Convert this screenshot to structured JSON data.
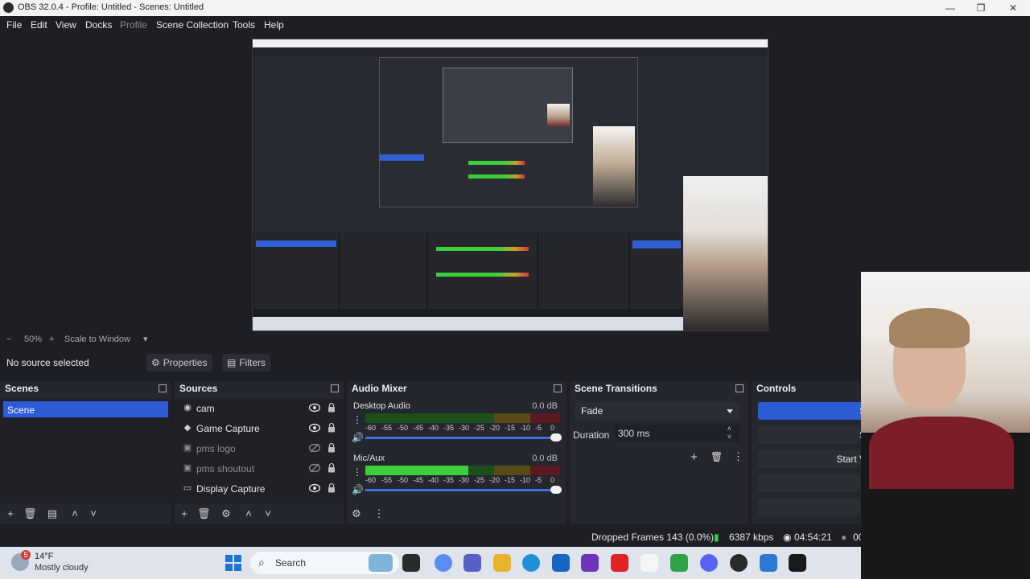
{
  "window": {
    "title": "OBS 32.0.4 - Profile: Untitled - Scenes: Untitled",
    "minimize": "—",
    "maximize": "❐",
    "close": "✕"
  },
  "menu": [
    "File",
    "Edit",
    "View",
    "Docks",
    "Profile",
    "Scene Collection",
    "Tools",
    "Help"
  ],
  "zoom": {
    "minus": "−",
    "value": "50%",
    "plus": "+",
    "mode": "Scale to Window"
  },
  "source_toolbar": {
    "status": "No source selected",
    "properties_label": "Properties",
    "filters_label": "Filters"
  },
  "scenes": {
    "title": "Scenes",
    "items": [
      "Scene"
    ]
  },
  "sources": {
    "title": "Sources",
    "items": [
      {
        "name": "cam",
        "icon": "camera-icon",
        "visible": true
      },
      {
        "name": "Game Capture",
        "icon": "gamepad-icon",
        "visible": true
      },
      {
        "name": "pms logo",
        "icon": "image-icon",
        "visible": false
      },
      {
        "name": "pms shoutout",
        "icon": "image-icon",
        "visible": false
      },
      {
        "name": "Display Capture",
        "icon": "monitor-icon",
        "visible": true
      }
    ]
  },
  "mixer": {
    "title": "Audio Mixer",
    "channels": [
      {
        "name": "Desktop Audio",
        "db": "0.0 dB",
        "level": 0.0
      },
      {
        "name": "Mic/Aux",
        "db": "0.0 dB",
        "level": 0.53
      }
    ],
    "ticks": [
      "-60",
      "-55",
      "-50",
      "-45",
      "-40",
      "-35",
      "-30",
      "-25",
      "-20",
      "-15",
      "-10",
      "-5",
      "0"
    ]
  },
  "transitions": {
    "title": "Scene Transitions",
    "selected": "Fade",
    "duration_label": "Duration",
    "duration_value": "300 ms"
  },
  "controls": {
    "title": "Controls",
    "buttons": [
      "S",
      "S",
      "Start V"
    ]
  },
  "status": {
    "dropped_frames": "Dropped Frames 143 (0.0%)",
    "bitrate": "6387 kbps",
    "time": "04:54:21",
    "extra": "00"
  },
  "taskbar": {
    "badge": "5",
    "temperature": "14°F",
    "weather": "Mostly cloudy",
    "search": "Search"
  },
  "colors": {
    "accent": "#2e5bd6",
    "meter_green": "#3ccf3c",
    "meter_yellow": "#c8a02a",
    "meter_red": "#c83a3a"
  }
}
